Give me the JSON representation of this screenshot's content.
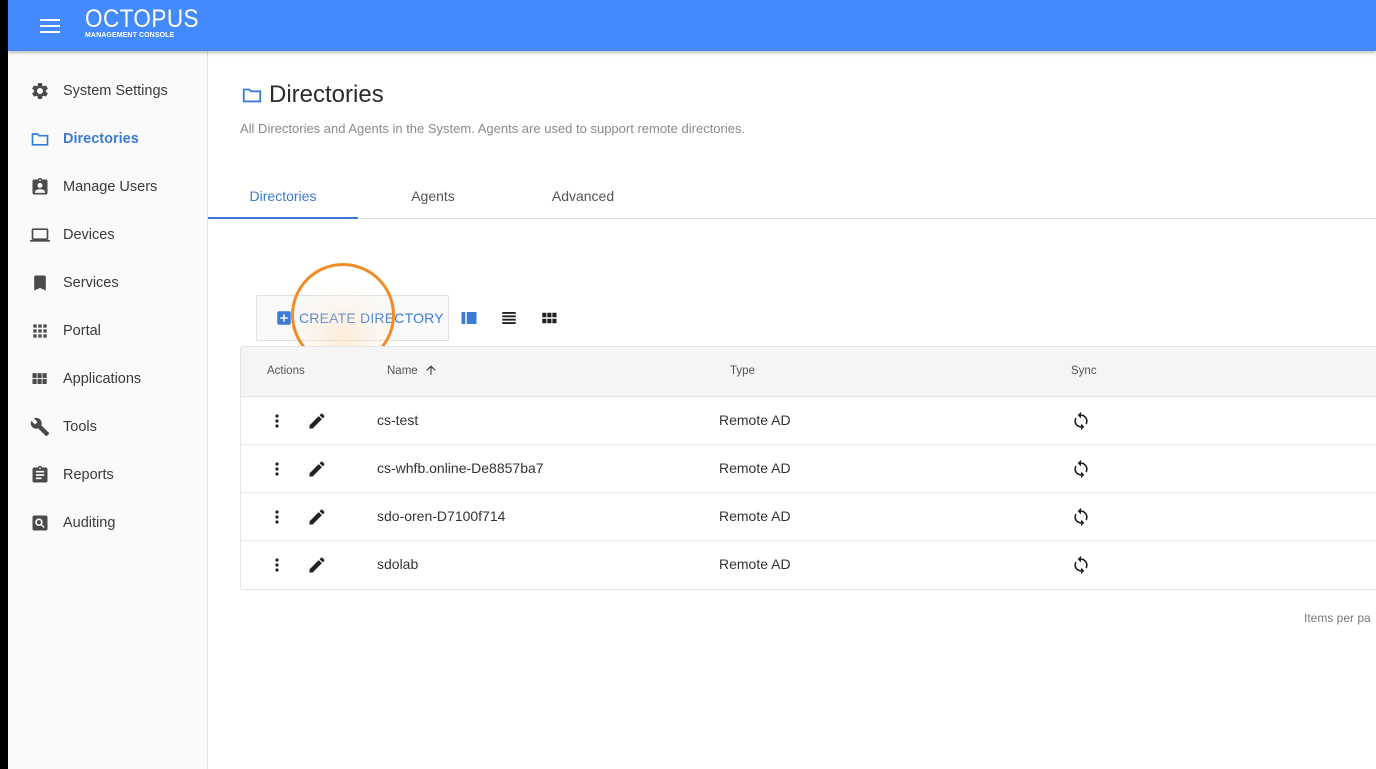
{
  "app": {
    "brand_title": "OCTOPUS",
    "brand_subtitle": "MANAGEMENT CONSOLE",
    "accent_color": "#448aff",
    "active_color": "#3b7bd6"
  },
  "sidebar": {
    "items": [
      {
        "label": "System Settings",
        "icon": "gear-icon",
        "active": false
      },
      {
        "label": "Directories",
        "icon": "folder-icon",
        "active": true
      },
      {
        "label": "Manage Users",
        "icon": "user-badge-icon",
        "active": false
      },
      {
        "label": "Devices",
        "icon": "laptop-icon",
        "active": false
      },
      {
        "label": "Services",
        "icon": "bookmark-icon",
        "active": false
      },
      {
        "label": "Portal",
        "icon": "apps-grid-icon",
        "active": false
      },
      {
        "label": "Applications",
        "icon": "view-module-icon",
        "active": false
      },
      {
        "label": "Tools",
        "icon": "wrench-icon",
        "active": false
      },
      {
        "label": "Reports",
        "icon": "clipboard-icon",
        "active": false
      },
      {
        "label": "Auditing",
        "icon": "search-box-icon",
        "active": false
      }
    ]
  },
  "page": {
    "title": "Directories",
    "description": "All Directories and Agents in the System. Agents are used to support remote directories."
  },
  "tabs": [
    {
      "label": "Directories",
      "active": true
    },
    {
      "label": "Agents",
      "active": false
    },
    {
      "label": "Advanced",
      "active": false
    }
  ],
  "toolbar": {
    "create_label": "CREATE DIRECTORY",
    "views": [
      "card-view-icon",
      "list-view-icon",
      "grid-view-icon"
    ]
  },
  "table": {
    "columns": [
      "Actions",
      "Name",
      "Type",
      "Sync"
    ],
    "sorted_by": "Name",
    "sort_direction": "ascending",
    "rows": [
      {
        "name": "cs-test",
        "type": "Remote AD"
      },
      {
        "name": "cs-whfb.online-De8857ba7",
        "type": "Remote AD"
      },
      {
        "name": "sdo-oren-D7100f714",
        "type": "Remote AD"
      },
      {
        "name": "sdolab",
        "type": "Remote AD"
      }
    ]
  },
  "footer": {
    "items_per_page": "Items per pa"
  }
}
